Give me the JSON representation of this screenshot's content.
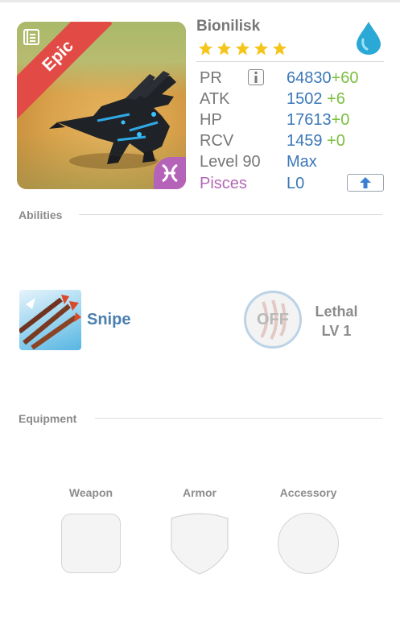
{
  "portrait": {
    "rarity": "Epic",
    "codex_icon": "codex-book-icon",
    "zodiac_icon": "pisces-icon",
    "creature_icon": "dragon-creature-icon",
    "rarity_color": "#e24a45",
    "zodiac_color": "#b463b9"
  },
  "creature": {
    "name": "Bionilisk",
    "stars": 5,
    "element_icon": "water-drop-icon",
    "element_color": "#2aa8d6"
  },
  "stats": {
    "pr": {
      "label": "PR",
      "value": "64830",
      "bonus": "+60"
    },
    "atk": {
      "label": "ATK",
      "value": "1502",
      "bonus": " +6"
    },
    "hp": {
      "label": "HP",
      "value": "17613",
      "bonus": "+0"
    },
    "rcv": {
      "label": "RCV",
      "value": "1459",
      "bonus": " +0"
    },
    "level": {
      "label": "Level 90",
      "value": "Max"
    },
    "zodiac": {
      "label": "Pisces",
      "value": "L0"
    }
  },
  "abilities": {
    "title": "Abilities",
    "active": {
      "name": "Snipe",
      "icon": "arrows-icon"
    },
    "passive": {
      "state": "OFF",
      "name": "Lethal",
      "level": "LV 1",
      "icon": "claw-icon"
    }
  },
  "equipment": {
    "title": "Equipment",
    "slots": [
      {
        "label": "Weapon"
      },
      {
        "label": "Armor"
      },
      {
        "label": "Accessory"
      }
    ]
  },
  "colors": {
    "value_blue": "#3b78b8",
    "bonus_green": "#7cbf3f",
    "pisces_purple": "#b467b8",
    "star_gold": "#f6c51b"
  }
}
